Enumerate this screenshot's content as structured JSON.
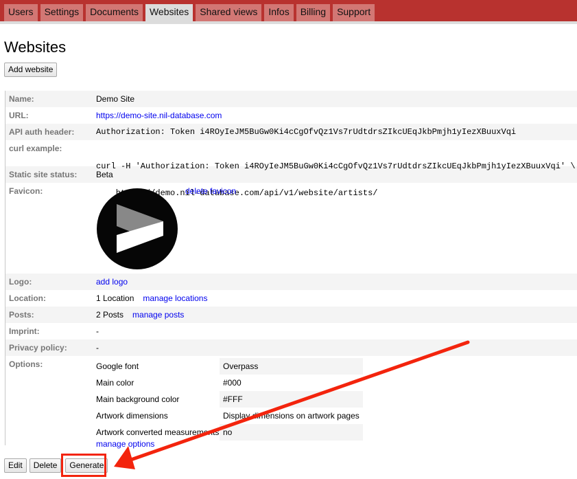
{
  "nav": {
    "tabs": [
      {
        "label": "Users",
        "active": false
      },
      {
        "label": "Settings",
        "active": false
      },
      {
        "label": "Documents",
        "active": false
      },
      {
        "label": "Websites",
        "active": true
      },
      {
        "label": "Shared views",
        "active": false
      },
      {
        "label": "Infos",
        "active": false
      },
      {
        "label": "Billing",
        "active": false
      },
      {
        "label": "Support",
        "active": false
      }
    ]
  },
  "page": {
    "title": "Websites",
    "add_button": "Add website"
  },
  "website": {
    "name_label": "Name:",
    "name": "Demo Site",
    "url_label": "URL:",
    "url": "https://demo-site.nil-database.com",
    "api_label": "API auth header:",
    "api_header": "Authorization: Token i4ROyIeJM5BuGw0Ki4cCgOfvQz1Vs7rUdtdrsZIkcUEqJkbPmjh1yIezXBuuxVqi",
    "curl_label": "curl example:",
    "curl_line1": "curl -H 'Authorization: Token i4ROyIeJM5BuGw0Ki4cCgOfvQz1Vs7rUdtdrsZIkcUEqJkbPmjh1yIezXBuuxVqi' \\",
    "curl_line2": "    https://demo.nil-database.com/api/v1/website/artists/",
    "status_label": "Static site status:",
    "status": "Beta",
    "favicon_label": "Favicon:",
    "favicon_delete": "delete favicon",
    "logo_label": "Logo:",
    "logo_add": "add logo",
    "location_label": "Location:",
    "location_count": "1 Location",
    "location_manage": "manage locations",
    "posts_label": "Posts:",
    "posts_count": "2 Posts",
    "posts_manage": "manage posts",
    "imprint_label": "Imprint:",
    "imprint": "-",
    "privacy_label": "Privacy policy:",
    "privacy": "-",
    "options_label": "Options:",
    "options": [
      {
        "key": "Google font",
        "value": "Overpass"
      },
      {
        "key": "Main color",
        "value": "#000"
      },
      {
        "key": "Main background color",
        "value": "#FFF"
      },
      {
        "key": "Artwork dimensions",
        "value": "Display dimensions on artwork pages"
      },
      {
        "key": "Artwork converted measurements",
        "value": "no"
      }
    ],
    "options_manage": "manage options"
  },
  "actions": {
    "edit": "Edit",
    "delete": "Delete",
    "generate": "Generate"
  },
  "annotation": {
    "color": "#f3240d"
  }
}
